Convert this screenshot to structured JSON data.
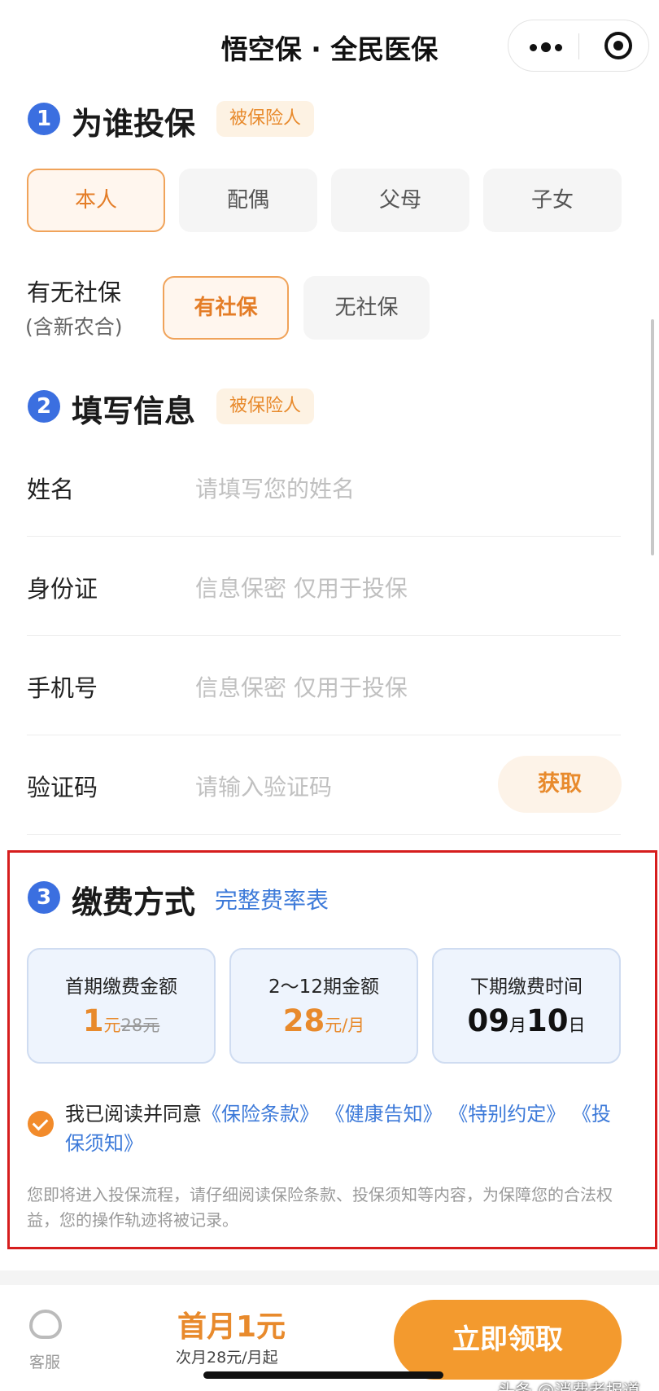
{
  "header": {
    "title": "悟空保 · 全民医保"
  },
  "step1": {
    "num": "1",
    "title": "为谁投保",
    "tag": "被保险人",
    "options": [
      "本人",
      "配偶",
      "父母",
      "子女"
    ],
    "selected": "本人",
    "social_label": "有无社保",
    "social_sub": "(含新农合)",
    "social_options": [
      "有社保",
      "无社保"
    ],
    "social_selected": "有社保"
  },
  "step2": {
    "num": "2",
    "title": "填写信息",
    "tag": "被保险人",
    "fields": [
      {
        "label": "姓名",
        "placeholder": "请填写您的姓名"
      },
      {
        "label": "身份证",
        "placeholder": "信息保密 仅用于投保"
      },
      {
        "label": "手机号",
        "placeholder": "信息保密 仅用于投保"
      },
      {
        "label": "验证码",
        "placeholder": "请输入验证码"
      }
    ],
    "get_code": "获取"
  },
  "step3": {
    "num": "3",
    "title": "缴费方式",
    "rate_link": "完整费率表",
    "cards": [
      {
        "label": "首期缴费金额",
        "amount": "1",
        "unit": "元",
        "original": "28元"
      },
      {
        "label": "2～12期金额",
        "amount": "28",
        "unit": "元/月"
      },
      {
        "label": "下期缴费时间",
        "month": "09",
        "month_unit": "月",
        "day": "10",
        "day_unit": "日"
      }
    ],
    "agree_prefix": "我已阅读并同意",
    "agree_links": [
      "《保险条款》",
      "《健康告知》",
      "《特别约定》",
      "《投保须知》"
    ],
    "notice": "您即将进入投保流程，请仔细阅读保险条款、投保须知等内容，为保障您的合法权益，您的操作轨迹将被记录。"
  },
  "bottom": {
    "service_label": "客服",
    "price_main": "首月1元",
    "price_sub": "次月28元/月起",
    "cta": "立即领取"
  },
  "watermark": "头条 @消费者报道",
  "colors": {
    "accent": "#e88a2c",
    "blue": "#3b6fe0",
    "link": "#3d7ad9",
    "highlight_border": "#d61d1d"
  }
}
